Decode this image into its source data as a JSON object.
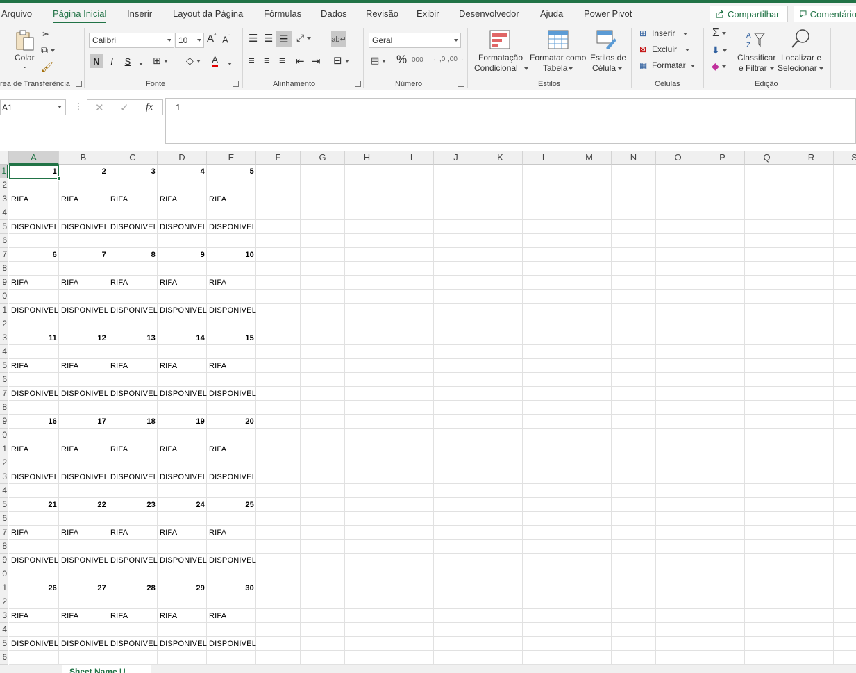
{
  "menu": {
    "tabs": [
      "Arquivo",
      "Página Inicial",
      "Inserir",
      "Layout da Página",
      "Fórmulas",
      "Dados",
      "Revisão",
      "Exibir",
      "Desenvolvedor",
      "Ajuda",
      "Power Pivot"
    ],
    "active_tab": "Página Inicial",
    "share_label": "Compartilhar",
    "comments_label": "Comentário"
  },
  "ribbon": {
    "clipboard": {
      "paste_label": "Colar",
      "group_label": "rea de Transferência"
    },
    "font": {
      "font_name": "Calibri",
      "font_size": "10",
      "bold": "N",
      "italic": "I",
      "underline": "S",
      "group_label": "Fonte"
    },
    "alignment": {
      "group_label": "Alinhamento"
    },
    "number": {
      "format": "Geral",
      "group_label": "Número"
    },
    "styles": {
      "cond_format_line1": "Formatação",
      "cond_format_line2": "Condicional",
      "format_table_line1": "Formatar como",
      "format_table_line2": "Tabela",
      "cell_styles_line1": "Estilos de",
      "cell_styles_line2": "Célula",
      "group_label": "Estilos"
    },
    "cells": {
      "insert": "Inserir",
      "delete": "Excluir",
      "format": "Formatar",
      "group_label": "Células"
    },
    "editing": {
      "sort_line1": "Classificar",
      "sort_line2": "e Filtrar",
      "find_line1": "Localizar e",
      "find_line2": "Selecionar",
      "group_label": "Edição"
    }
  },
  "formula_bar": {
    "name_box": "A1",
    "value": "1",
    "fx": "fx"
  },
  "sheet": {
    "columns": [
      "A",
      "B",
      "C",
      "D",
      "E",
      "F",
      "G",
      "H",
      "I",
      "J",
      "K",
      "L",
      "M",
      "N",
      "O",
      "P",
      "Q",
      "R",
      "S"
    ],
    "selected_column": "A",
    "row_labels": [
      "1",
      "2",
      "3",
      "4",
      "5",
      "6",
      "7",
      "8",
      "9",
      "0",
      "1",
      "2",
      "3",
      "4",
      "5",
      "6",
      "7",
      "8",
      "9",
      "0",
      "1",
      "2",
      "3",
      "4",
      "5",
      "6",
      "7",
      "8",
      "9",
      "0",
      "1",
      "2",
      "3",
      "4",
      "5",
      "6"
    ],
    "rows": [
      [
        "1",
        "2",
        "3",
        "4",
        "5"
      ],
      [],
      [
        "RIFA",
        "RIFA",
        "RIFA",
        "RIFA",
        "RIFA"
      ],
      [],
      [
        "DISPONIVEL",
        "DISPONIVEL",
        "DISPONIVEL",
        "DISPONIVEL",
        "DISPONIVEL"
      ],
      [],
      [
        "6",
        "7",
        "8",
        "9",
        "10"
      ],
      [],
      [
        "RIFA",
        "RIFA",
        "RIFA",
        "RIFA",
        "RIFA"
      ],
      [],
      [
        "DISPONIVEL",
        "DISPONIVEL",
        "DISPONIVEL",
        "DISPONIVEL",
        "DISPONIVEL"
      ],
      [],
      [
        "11",
        "12",
        "13",
        "14",
        "15"
      ],
      [],
      [
        "RIFA",
        "RIFA",
        "RIFA",
        "RIFA",
        "RIFA"
      ],
      [],
      [
        "DISPONIVEL",
        "DISPONIVEL",
        "DISPONIVEL",
        "DISPONIVEL",
        "DISPONIVEL"
      ],
      [],
      [
        "16",
        "17",
        "18",
        "19",
        "20"
      ],
      [],
      [
        "RIFA",
        "RIFA",
        "RIFA",
        "RIFA",
        "RIFA"
      ],
      [],
      [
        "DISPONIVEL",
        "DISPONIVEL",
        "DISPONIVEL",
        "DISPONIVEL",
        "DISPONIVEL"
      ],
      [],
      [
        "21",
        "22",
        "23",
        "24",
        "25"
      ],
      [],
      [
        "RIFA",
        "RIFA",
        "RIFA",
        "RIFA",
        "RIFA"
      ],
      [],
      [
        "DISPONIVEL",
        "DISPONIVEL",
        "DISPONIVEL",
        "DISPONIVEL",
        "DISPONIVEL"
      ],
      [],
      [
        "26",
        "27",
        "28",
        "29",
        "30"
      ],
      [],
      [
        "RIFA",
        "RIFA",
        "RIFA",
        "RIFA",
        "RIFA"
      ],
      [],
      [
        "DISPONIVEL",
        "DISPONIVEL",
        "DISPONIVEL",
        "DISPONIVEL",
        "DISPONIVEL"
      ],
      []
    ],
    "sheet_tab": "Sheet Name U"
  },
  "colors": {
    "accent": "#217346"
  }
}
